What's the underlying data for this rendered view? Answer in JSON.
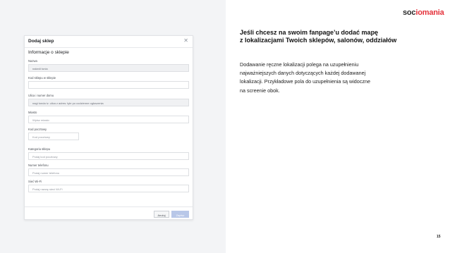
{
  "brand": {
    "logo_part1": "soc",
    "logo_part2": "i",
    "logo_part3": "omania",
    "accent_color": "#e4323b"
  },
  "modal": {
    "title": "Dodaj sklep",
    "close_icon": "close-icon",
    "section_title": "Informacje o sklepie",
    "fields": [
      {
        "label": "Nazwa",
        "value": "nakedi tonia"
      },
      {
        "label": "Kod sklepu w sklepie",
        "value": ""
      },
      {
        "label": "Ulica i numer domu",
        "value": "nagi tonda iv. ulica z adres: tyle po codzienne ogłoszenia"
      },
      {
        "label": "Miasto",
        "value": "Wpisz miasto"
      },
      {
        "label": "Kod pocztowy",
        "value": "Kod pocztowy"
      },
      {
        "label": "Kategoria sklepu",
        "value": "Podaj kod pocztowy"
      },
      {
        "label": "Numer telefonu",
        "value": "Podaj numer telefonu"
      },
      {
        "label": "Sieć Wi-Fi",
        "value": "Podaj nazwę sieci Wi-Fi"
      }
    ],
    "cancel_label": "Anuluj",
    "save_label": "Zapisz"
  },
  "content": {
    "heading_line1": "Jeśli chcesz na swoim fanpage’u dodać mapę",
    "heading_line2": "z lokalizacjami Twoich sklepów, salonów, oddziałów",
    "body_line1": "Dodawanie ręczne lokalizacji polega na uzupełnieniu",
    "body_line2": "najważniejszych danych dotyczących każdej dodawanej",
    "body_line3": "lokalizacji. Przykładowe pola do uzupełnienia są widoczne",
    "body_line4": "na screenie obok."
  },
  "page_number": "15"
}
